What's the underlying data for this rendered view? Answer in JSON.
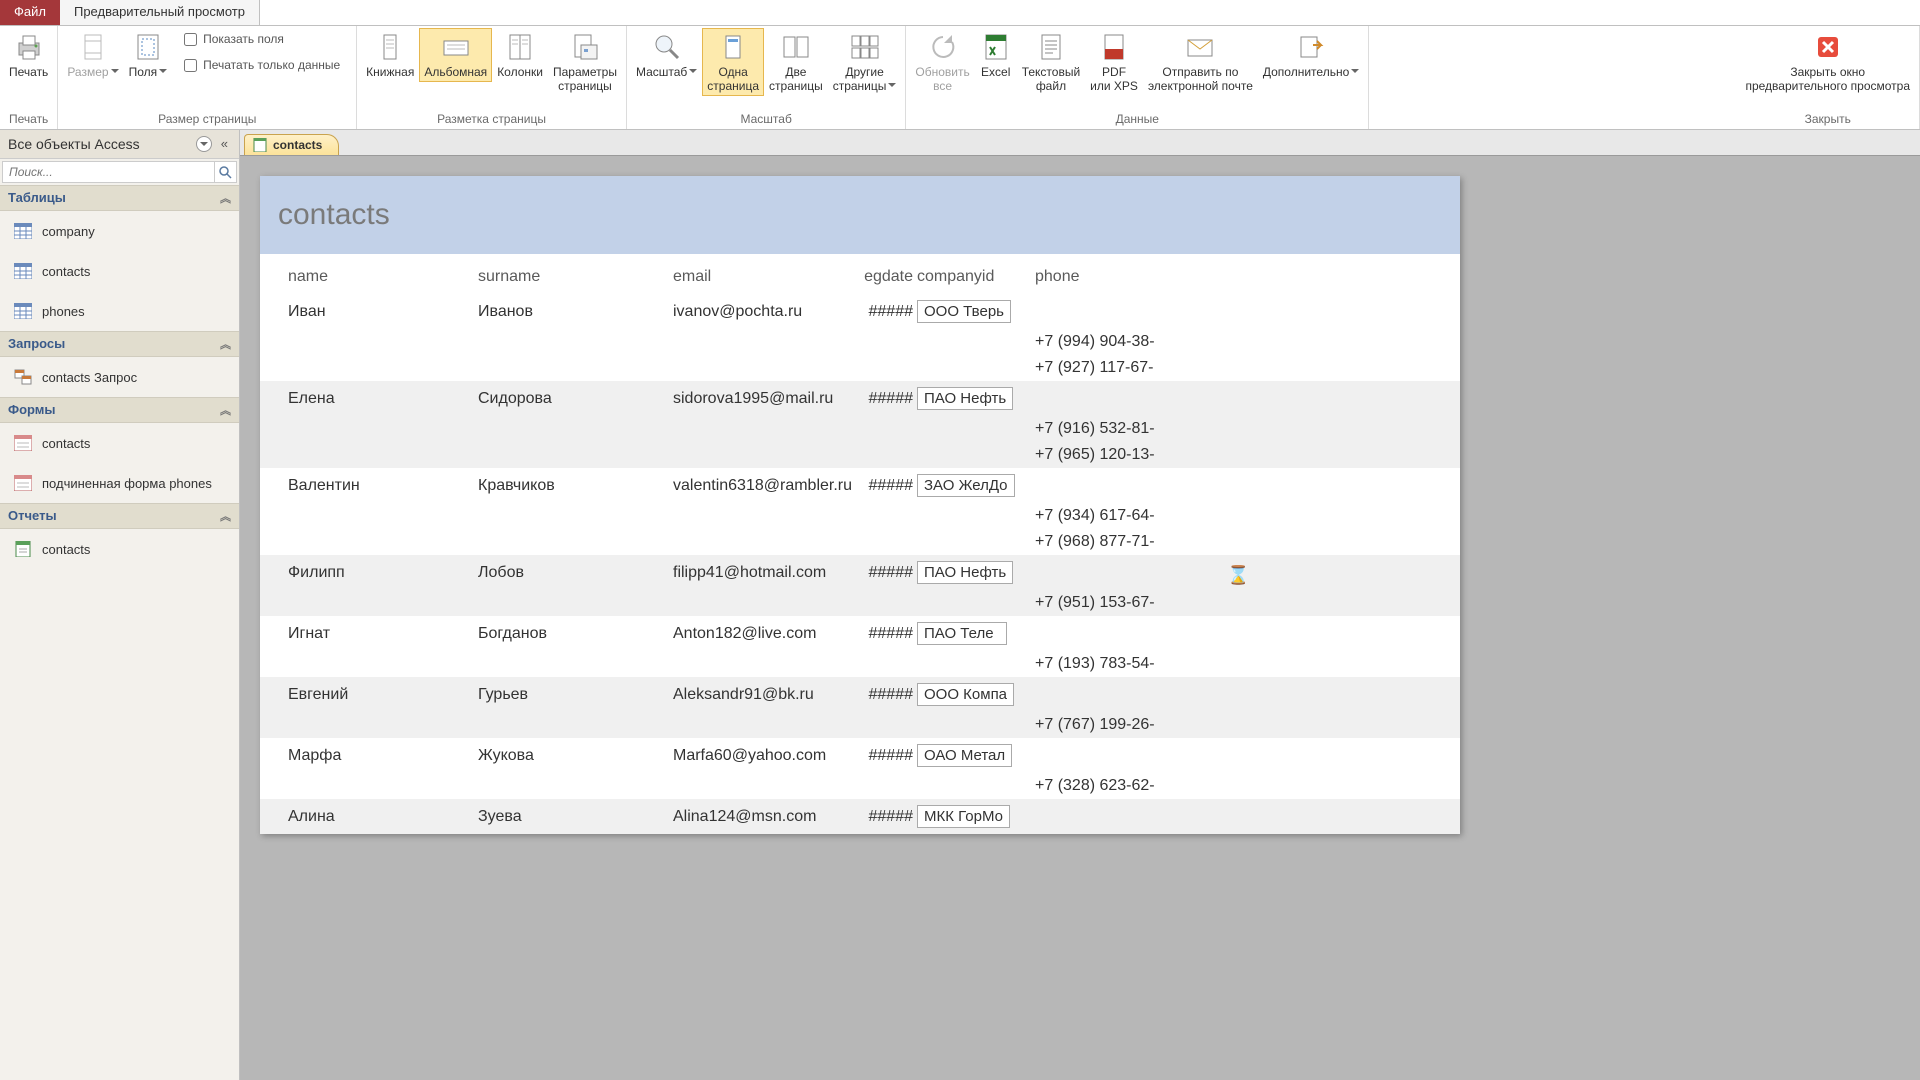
{
  "tabs": {
    "file": "Файл",
    "preview": "Предварительный просмотр"
  },
  "ribbon": {
    "print": {
      "label": "Печать",
      "group": "Печать"
    },
    "size": "Размер",
    "margins": "Поля",
    "show_fields": "Показать поля",
    "print_data_only": "Печатать только данные",
    "page_size_group": "Размер страницы",
    "portrait": "Книжная",
    "landscape": "Альбомная",
    "columns": "Колонки",
    "page_setup": "Параметры\nстраницы",
    "layout_group": "Разметка страницы",
    "zoom": "Масштаб",
    "one_page": "Одна\nстраница",
    "two_pages": "Две\nстраницы",
    "more_pages": "Другие\nстраницы",
    "zoom_group": "Масштаб",
    "refresh": "Обновить\nвсе",
    "excel": "Excel",
    "text_file": "Текстовый\nфайл",
    "pdf": "PDF\nили XPS",
    "email": "Отправить по\nэлектронной почте",
    "more_export": "Дополнительно",
    "data_group": "Данные",
    "close": "Закрыть окно\nпредварительного просмотра",
    "close_group": "Закрыть"
  },
  "nav": {
    "header": "Все объекты Access",
    "search_placeholder": "Поиск...",
    "sections": {
      "tables": "Таблицы",
      "queries": "Запросы",
      "forms": "Формы",
      "reports": "Отчеты"
    },
    "items": {
      "company": "company",
      "contacts_tbl": "contacts",
      "phones": "phones",
      "contacts_query": "contacts Запрос",
      "contacts_form": "contacts",
      "phones_subform": "подчиненная форма phones",
      "contacts_report": "contacts"
    }
  },
  "doc_tab": "contacts",
  "report": {
    "title": "contacts",
    "columns": {
      "name": "name",
      "surname": "surname",
      "email": "email",
      "regdate": "egdate",
      "companyid": "companyid",
      "phone": "phone"
    },
    "rows": [
      {
        "name": "Иван",
        "surname": "Иванов",
        "email": "ivanov@pochta.ru",
        "reg": "#####",
        "company": "ООО Тверь",
        "phones": [
          "+7 (994) 904-38-",
          "+7 (927) 117-67-"
        ],
        "alt": false
      },
      {
        "name": "Елена",
        "surname": "Сидорова",
        "email": "sidorova1995@mail.ru",
        "reg": "#####",
        "company": "ПАО Нефть",
        "phones": [
          "+7 (916) 532-81-",
          "+7 (965) 120-13-"
        ],
        "alt": true
      },
      {
        "name": "Валентин",
        "surname": "Кравчиков",
        "email": "valentin6318@rambler.ru",
        "reg": "#####",
        "company": "ЗАО ЖелДо",
        "phones": [
          "+7 (934) 617-64-",
          "+7 (968) 877-71-"
        ],
        "alt": false
      },
      {
        "name": "Филипп",
        "surname": "Лобов",
        "email": "filipp41@hotmail.com",
        "reg": "#####",
        "company": "ПАО Нефть",
        "phones": [
          "+7 (951) 153-67-"
        ],
        "alt": true
      },
      {
        "name": "Игнат",
        "surname": "Богданов",
        "email": "Anton182@live.com",
        "reg": "#####",
        "company": "ПАО Теле",
        "phones": [
          "+7 (193) 783-54-"
        ],
        "alt": false
      },
      {
        "name": "Евгений",
        "surname": "Гурьев",
        "email": "Aleksandr91@bk.ru",
        "reg": "#####",
        "company": "ООО Компа",
        "phones": [
          "+7 (767) 199-26-"
        ],
        "alt": true
      },
      {
        "name": "Марфа",
        "surname": "Жукова",
        "email": "Marfa60@yahoo.com",
        "reg": "#####",
        "company": "ОАО Метал",
        "phones": [
          "+7 (328) 623-62-"
        ],
        "alt": false
      },
      {
        "name": "Алина",
        "surname": "Зуева",
        "email": "Alina124@msn.com",
        "reg": "#####",
        "company": "МКК ГорМо",
        "phones": [],
        "alt": true
      }
    ]
  }
}
